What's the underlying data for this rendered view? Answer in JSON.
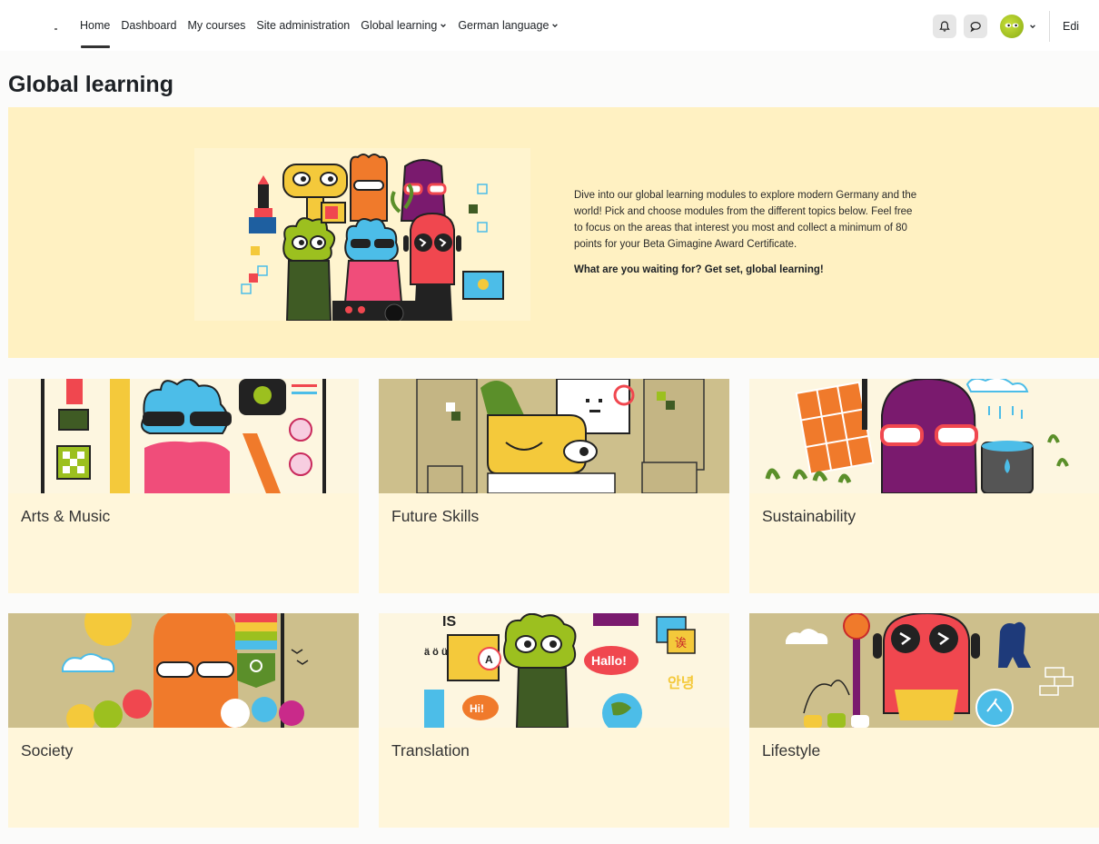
{
  "nav": {
    "items": [
      {
        "label": "Home",
        "active": true,
        "dropdown": false
      },
      {
        "label": "Dashboard",
        "active": false,
        "dropdown": false
      },
      {
        "label": "My courses",
        "active": false,
        "dropdown": false
      },
      {
        "label": "Site administration",
        "active": false,
        "dropdown": false
      },
      {
        "label": "Global learning",
        "active": false,
        "dropdown": true
      },
      {
        "label": "German language",
        "active": false,
        "dropdown": true
      }
    ],
    "edit_label": "Edi"
  },
  "icons": {
    "notifications": "bell-icon",
    "messages": "chat-bubble-icon",
    "user_menu": "chevron-down-icon"
  },
  "page": {
    "title": "Global learning"
  },
  "hero": {
    "description": "Dive into our global learning modules to explore modern Germany and the world! Pick and choose modules from the different topics below. Feel free to focus on the areas that interest you most and collect a minimum of 80 points for your Beta Gimagine Award Certificate.",
    "call_to_action": "What are you waiting for? Get set, global learning!"
  },
  "cards": [
    {
      "title": "Arts & Music"
    },
    {
      "title": "Future Skills"
    },
    {
      "title": "Sustainability"
    },
    {
      "title": "Society"
    },
    {
      "title": "Translation"
    },
    {
      "title": "Lifestyle"
    }
  ],
  "card_art_text": {
    "translation_speech": "Hallo!",
    "translation_hi": "Hi!",
    "translation_letter": "A",
    "translation_chinese": "诶",
    "translation_korean": "안녕",
    "translation_umlauts": "ä ö ü",
    "translation_is": "IS"
  },
  "colors": {
    "hero_bg": "#fff1c2",
    "card_bg": "#fff6da",
    "nav_active": "#333333",
    "accent_orange": "#f07a2b",
    "accent_green": "#9cc01f",
    "accent_blue": "#4cbde8",
    "accent_purple": "#7a1a6e",
    "accent_red": "#f0474f",
    "accent_yellow": "#f4c93b",
    "card_tan": "#cdbf8c"
  }
}
